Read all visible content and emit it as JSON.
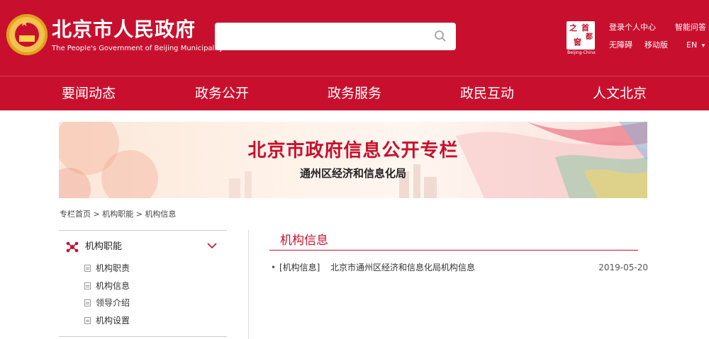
{
  "header": {
    "title": "北京市人民政府",
    "subtitle": "The People's Government of Beijing Municipality",
    "search": {
      "placeholder": ""
    },
    "logo": {
      "chars": [
        "之",
        "首",
        "都",
        "窗"
      ],
      "caption": "Beijing-China"
    },
    "links": {
      "login": "登录个人中心",
      "qa": "智能问答",
      "accessibility": "无障碍",
      "mobile": "移动版",
      "lang": "EN",
      "lang_caret": "▾"
    }
  },
  "nav": {
    "items": [
      "要闻动态",
      "政务公开",
      "政务服务",
      "政民互动",
      "人文北京"
    ]
  },
  "banner": {
    "title": "北京市政府信息公开专栏",
    "subtitle": "通州区经济和信息化局"
  },
  "breadcrumb": {
    "items": [
      "专栏首页",
      "机构职能",
      "机构信息"
    ],
    "separator": ">"
  },
  "sidebar": {
    "heading": "机构职能",
    "items": [
      "机构职责",
      "机构信息",
      "领导介绍",
      "机构设置"
    ]
  },
  "main": {
    "section_title": "机构信息",
    "articles": [
      {
        "bullet": "•",
        "category": "[机构信息]",
        "title": "北京市通州区经济和信息化局机构信息",
        "date": "2019-05-20"
      }
    ]
  },
  "colors": {
    "brand_red": "#c8102e",
    "gold": "#f2c14e"
  },
  "icons": {
    "search": "search-icon",
    "emblem": "national-emblem-icon",
    "sidebar_heading": "org-network-icon",
    "chevron": "chevron-down-icon",
    "document": "document-icon"
  }
}
